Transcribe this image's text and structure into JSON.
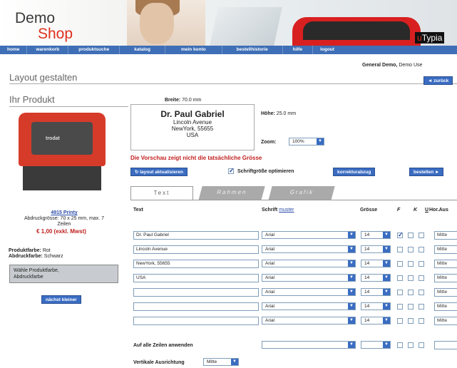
{
  "header": {
    "logo_line1": "Demo",
    "logo_line2": "Shop",
    "brand_u": "u",
    "brand_rest": "Typia"
  },
  "nav": [
    "home",
    "warenkorb",
    "produktsuche",
    "katalog",
    "mein konto",
    "bestellhistorie",
    "hilfe",
    "logout"
  ],
  "page": {
    "title": "Layout gestalten",
    "user_name": "General Demo,",
    "user_rest": "Demo Use",
    "back_label": "◄ zurück"
  },
  "product": {
    "section_title": "Ihr Produkt",
    "image_label": "trodat",
    "name": "4915 Printy",
    "size_info_line1": "Abdruckgrösse: 70 x 25 mm, max. 7",
    "size_info_line2": "Zeilen",
    "price": "€ 1,00 (exkl. Mwst)",
    "color_label": "Produktfarbe:",
    "color_value": "Rot",
    "ink_label": "Abdruckfarbe:",
    "ink_value": "Schwarz",
    "choose_color_line1": "Wähle Produktfarbe,",
    "choose_color_line2": "Abdruckfarbe",
    "next_smaller": "nächst kleiner"
  },
  "preview": {
    "width_label": "Breite:",
    "width_value": "70.0 mm",
    "height_label": "Höhe:",
    "height_value": "25.0 mm",
    "zoom_label": "Zoom:",
    "zoom_value": "100%",
    "lines": [
      "Dr. Paul Gabriel",
      "Lincoln Avenue",
      "NewYork, 55655",
      "USA"
    ],
    "warning": "Die Vorschau zeigt nicht die tatsächliche Grösse"
  },
  "actions": {
    "update_layout": "↻ layout aktualisieren",
    "optimize_font": "Schriftgröße optimieren",
    "proof": "korrekturabzug",
    "order": "bestellen ►"
  },
  "tabs": [
    "Text",
    "Rahmen",
    "Grafik"
  ],
  "table": {
    "headers": {
      "text": "Text",
      "font": "Schrift",
      "font_link": "muster",
      "size": "Grösse",
      "bold": "F",
      "italic": "K",
      "underline": "U",
      "align": "Hor.Aus"
    },
    "rows": [
      {
        "text": "Dr. Paul Gabriel",
        "font": "Arial",
        "size": "14",
        "bold": true,
        "align": "Mitte"
      },
      {
        "text": "Lincoln Avenue",
        "font": "Arial",
        "size": "14",
        "bold": false,
        "align": "Mitte"
      },
      {
        "text": "NewYork, 55655",
        "font": "Arial",
        "size": "14",
        "bold": false,
        "align": "Mitte"
      },
      {
        "text": "USA",
        "font": "Arial",
        "size": "14",
        "bold": false,
        "align": "Mitte"
      },
      {
        "text": "",
        "font": "Arial",
        "size": "14",
        "bold": false,
        "align": "Mitte"
      },
      {
        "text": "",
        "font": "Arial",
        "size": "14",
        "bold": false,
        "align": "Mitte"
      },
      {
        "text": "",
        "font": "Arial",
        "size": "14",
        "bold": false,
        "align": "Mitte"
      }
    ],
    "apply_all": "Auf alle Zeilen anwenden",
    "vertical_align_label": "Vertikale Ausrichtung",
    "vertical_align_value": "Mitte"
  }
}
